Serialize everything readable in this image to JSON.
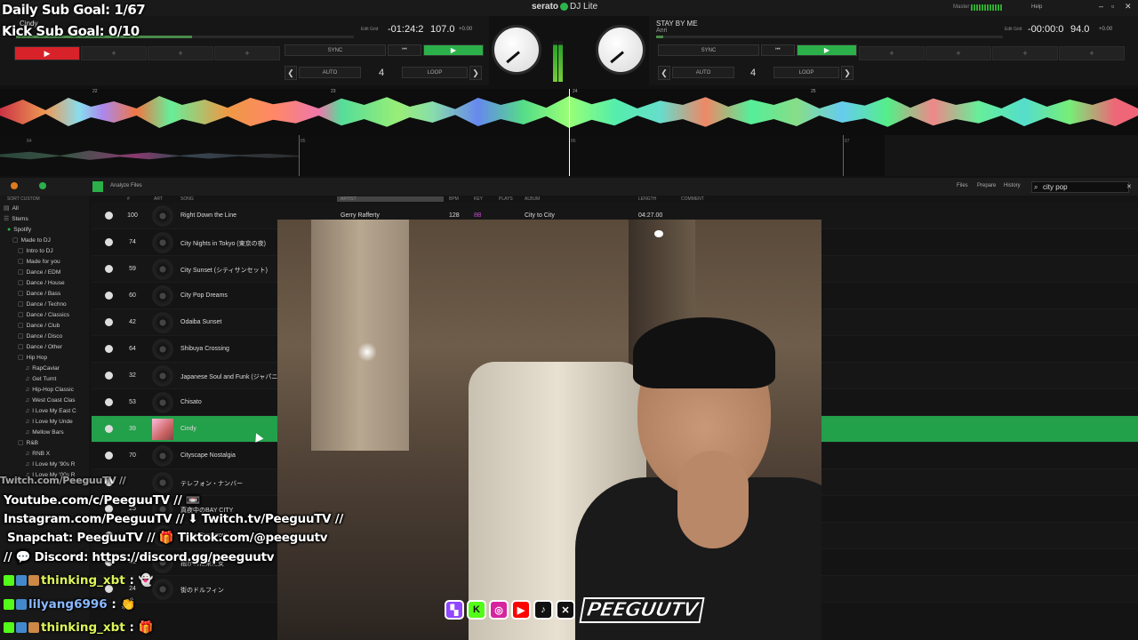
{
  "overlay": {
    "daily_goal": "Daily Sub Goal: 1/67",
    "kick_goal": "Kick Sub Goal: 0/10"
  },
  "app": {
    "brand": "serato",
    "product": "DJ Lite",
    "master": "Master",
    "help": "Help"
  },
  "deck_left": {
    "title": "Cindy",
    "time": "-01:24:2",
    "bpm": "107.0",
    "pitch": "+0.00",
    "edit_grid": "Edit Grid"
  },
  "deck_right": {
    "title": "STAY BY ME",
    "artist": "Anri",
    "time": "-00:00:0",
    "bpm": "94.0",
    "pitch": "+0.00",
    "edit_grid": "Edit Grid"
  },
  "controls": {
    "sync": "SYNC",
    "auto": "AUTO",
    "loop": "LOOP",
    "loop_value": "4",
    "prev": "⏮",
    "play": "▶",
    "left": "❮",
    "right": "❯",
    "plus": "+"
  },
  "wave_markers": [
    "22",
    "23",
    "24",
    "25"
  ],
  "wave2_markers": [
    "84",
    "85",
    "86",
    "87"
  ],
  "library": {
    "toolbar": {
      "analyze": "Analyze Files",
      "files": "Files",
      "prepare": "Prepare",
      "history": "History",
      "search": "city pop"
    },
    "sort": "SORT CUSTOM",
    "columns": {
      "num": "#",
      "art": "ART",
      "song": "SONG",
      "artist": "ARTIST",
      "bpm": "BPM",
      "key": "KEY",
      "plays": "PLAYS",
      "album": "ALBUM",
      "length": "LENGTH",
      "comment": "COMMENT"
    },
    "sidebar": [
      {
        "label": "All",
        "icon": "▤"
      },
      {
        "label": "Stems",
        "icon": "☰"
      },
      {
        "label": "Spotify",
        "icon": "●"
      },
      {
        "label": "Made to DJ",
        "icon": "▢"
      },
      {
        "label": "Intro to DJ",
        "icon": "▢"
      },
      {
        "label": "Made for you",
        "icon": "▢"
      },
      {
        "label": "Dance / EDM",
        "icon": "▢"
      },
      {
        "label": "Dance / House",
        "icon": "▢"
      },
      {
        "label": "Dance / Bass",
        "icon": "▢"
      },
      {
        "label": "Dance / Techno",
        "icon": "▢"
      },
      {
        "label": "Dance / Classics",
        "icon": "▢"
      },
      {
        "label": "Dance / Club",
        "icon": "▢"
      },
      {
        "label": "Dance / Disco",
        "icon": "▢"
      },
      {
        "label": "Dance / Other",
        "icon": "▢"
      },
      {
        "label": "Hip Hop",
        "icon": "▢"
      },
      {
        "label": "RapCaviar",
        "icon": "♫"
      },
      {
        "label": "Get Turnt",
        "icon": "♫"
      },
      {
        "label": "Hip-Hop Classic",
        "icon": "♫"
      },
      {
        "label": "West Coast Clas",
        "icon": "♫"
      },
      {
        "label": "I Love My East C",
        "icon": "♫"
      },
      {
        "label": "I Love My Unde",
        "icon": "♫"
      },
      {
        "label": "Mellow Bars",
        "icon": "♫"
      },
      {
        "label": "R&B",
        "icon": "▢"
      },
      {
        "label": "RNB X",
        "icon": "♫"
      },
      {
        "label": "I Love My '90s R",
        "icon": "♫"
      },
      {
        "label": "I Love My '00s R",
        "icon": "♫"
      }
    ],
    "rows": [
      {
        "plays": "100",
        "song": "Right Down the Line",
        "artist": "Gerry Rafferty",
        "bpm": "128",
        "key": "8B",
        "album": "City to City",
        "length": "04:27.00"
      },
      {
        "plays": "74",
        "song": "City Nights in Tokyo (東京の夜)"
      },
      {
        "plays": "59",
        "song": "City Sunset (シティサンセット)"
      },
      {
        "plays": "60",
        "song": "City Pop Dreams"
      },
      {
        "plays": "42",
        "song": "Odaiba Sunset"
      },
      {
        "plays": "64",
        "song": "Shibuya Crossing"
      },
      {
        "plays": "32",
        "song": "Japanese Soul and Funk (ジャパニーズ"
      },
      {
        "plays": "53",
        "song": "Chisato"
      },
      {
        "plays": "39",
        "song": "Cindy",
        "selected": true
      },
      {
        "plays": "70",
        "song": "Cityscape Nostalgia"
      },
      {
        "plays": "",
        "song": "テレフォン・ナンバー"
      },
      {
        "plays": "25",
        "song": "真夜中のBAY CITY"
      },
      {
        "plays": "",
        "song": "Friday Tomorrow"
      },
      {
        "plays": "41",
        "song": "抱かれに来た女"
      },
      {
        "plays": "24",
        "song": "街のドルフィン"
      }
    ]
  },
  "social": {
    "line1": "Twitch.com/PeeguuTV //",
    "line2": "Youtube.com/c/PeeguuTV // 📼",
    "line3": "Instagram.com/PeeguuTV // ⬇ Twitch.tv/PeeguuTV //",
    "line4": "Snapchat: PeeguuTV // 🎁 Tiktok.com/@peeguutv",
    "line5": "// 💬 Discord: https://discord.gg/peeguutv"
  },
  "chat": [
    {
      "user": "thinking_xbt",
      "msg": ":"
    },
    {
      "user": "lilyang6996",
      "msg": ":"
    },
    {
      "user": "thinking_xbt",
      "msg": ":"
    }
  ],
  "brand_logo": "PEEGUUTV"
}
